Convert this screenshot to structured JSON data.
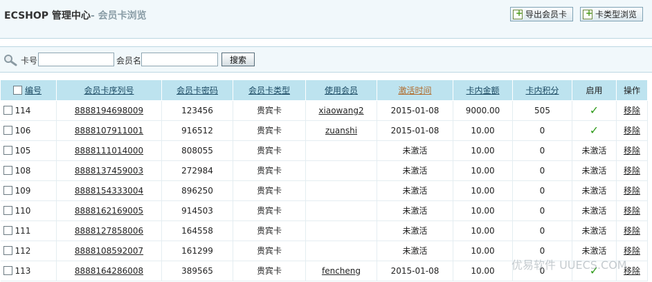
{
  "header": {
    "brand": "ECSHOP 管理中心",
    "section": "- 会员卡浏览",
    "buttons": [
      {
        "label": "导出会员卡",
        "icon": "export-icon"
      },
      {
        "label": "卡类型浏览",
        "icon": "card-type-icon"
      }
    ]
  },
  "search": {
    "card_no_label": "卡号",
    "card_no_value": "",
    "member_label": "会员名",
    "member_value": "",
    "button_label": "搜索"
  },
  "table": {
    "columns": [
      "编号",
      "会员卡序列号",
      "会员卡密码",
      "会员卡类型",
      "使用会员",
      "激活时间",
      "卡内金额",
      "卡内积分",
      "启用",
      "操作"
    ],
    "rows": [
      {
        "id": "114",
        "serial": "8888194698009",
        "password": "123456",
        "type": "贵宾卡",
        "member": "xiaowang2",
        "activated": "2015-01-08",
        "amount": "9000.00",
        "points": "505",
        "enabled": "✓",
        "action": "移除"
      },
      {
        "id": "106",
        "serial": "8888107911001",
        "password": "916512",
        "type": "贵宾卡",
        "member": "zuanshi",
        "activated": "2015-01-08",
        "amount": "10.00",
        "points": "0",
        "enabled": "✓",
        "action": "移除"
      },
      {
        "id": "105",
        "serial": "8888111014000",
        "password": "808055",
        "type": "贵宾卡",
        "member": "",
        "activated": "未激活",
        "amount": "10.00",
        "points": "0",
        "enabled": "未激活",
        "action": "移除"
      },
      {
        "id": "108",
        "serial": "8888137459003",
        "password": "272984",
        "type": "贵宾卡",
        "member": "",
        "activated": "未激活",
        "amount": "10.00",
        "points": "0",
        "enabled": "未激活",
        "action": "移除"
      },
      {
        "id": "109",
        "serial": "8888154333004",
        "password": "896250",
        "type": "贵宾卡",
        "member": "",
        "activated": "未激活",
        "amount": "10.00",
        "points": "0",
        "enabled": "未激活",
        "action": "移除"
      },
      {
        "id": "110",
        "serial": "8888162169005",
        "password": "914503",
        "type": "贵宾卡",
        "member": "",
        "activated": "未激活",
        "amount": "10.00",
        "points": "0",
        "enabled": "未激活",
        "action": "移除"
      },
      {
        "id": "111",
        "serial": "8888127858006",
        "password": "164558",
        "type": "贵宾卡",
        "member": "",
        "activated": "未激活",
        "amount": "10.00",
        "points": "0",
        "enabled": "未激活",
        "action": "移除"
      },
      {
        "id": "112",
        "serial": "8888108592007",
        "password": "161299",
        "type": "贵宾卡",
        "member": "",
        "activated": "未激活",
        "amount": "10.00",
        "points": "0",
        "enabled": "未激活",
        "action": "移除"
      },
      {
        "id": "113",
        "serial": "8888164286008",
        "password": "389565",
        "type": "贵宾卡",
        "member": "fencheng",
        "activated": "2015-01-08",
        "amount": "10.00",
        "points": "0",
        "enabled": "✓",
        "action": "移除"
      }
    ]
  },
  "watermark": "优易软件 UUECS.COM",
  "colors": {
    "header_bg": "#f1f8fb",
    "table_header_bg": "#bde3ef",
    "check": "#2f9b1a",
    "active_sort": "#b06a2b"
  }
}
